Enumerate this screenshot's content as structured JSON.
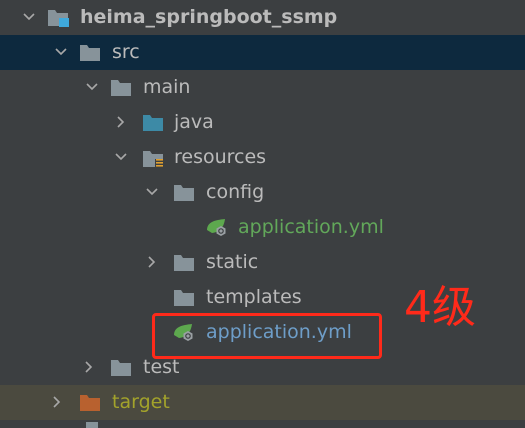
{
  "tree": {
    "items": [
      {
        "label": "heima_springboot_ssmp",
        "icon": "module-folder-icon",
        "expanded": true
      },
      {
        "label": "src",
        "icon": "folder-icon",
        "expanded": true,
        "selected": true
      },
      {
        "label": "main",
        "icon": "folder-icon",
        "expanded": true
      },
      {
        "label": "java",
        "icon": "source-folder-icon",
        "expanded": false
      },
      {
        "label": "resources",
        "icon": "resources-folder-icon",
        "expanded": true
      },
      {
        "label": "config",
        "icon": "folder-icon",
        "expanded": true
      },
      {
        "label": "application.yml",
        "icon": "spring-config-icon"
      },
      {
        "label": "static",
        "icon": "folder-icon",
        "expanded": false
      },
      {
        "label": "templates",
        "icon": "folder-icon"
      },
      {
        "label": "application.yml",
        "icon": "spring-config-icon"
      },
      {
        "label": "test",
        "icon": "folder-icon",
        "expanded": false
      },
      {
        "label": "target",
        "icon": "excluded-folder-icon",
        "expanded": false
      }
    ]
  },
  "annotation": {
    "text": "4级",
    "color": "#ff2a1a"
  },
  "colors": {
    "background": "#3c3f41",
    "selected": "#0d293e",
    "excluded": "#4b4a3f",
    "config_green": "#62a85a",
    "config_blue": "#6e9ec9"
  }
}
